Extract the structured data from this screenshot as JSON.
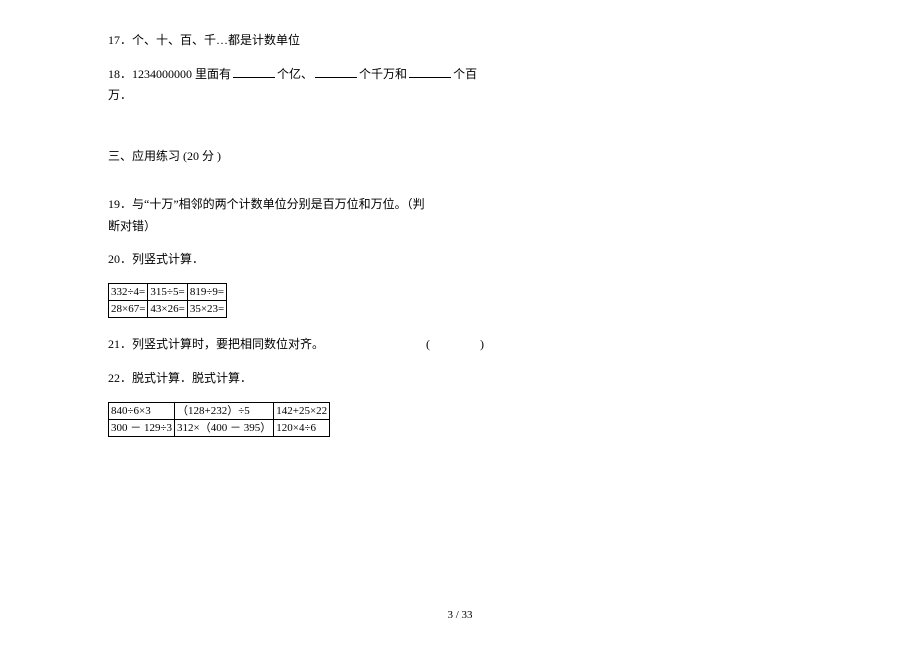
{
  "q17": {
    "num": "17．",
    "text": "个、十、百、千…都是计数单位"
  },
  "q18": {
    "num": "18．",
    "text_a": "1234000000 里面有",
    "text_b": "个亿、",
    "text_c": "个千万和",
    "text_d": "个百",
    "text_e": "万．"
  },
  "section3": {
    "title": "三、应用练习  (20  分 )"
  },
  "q19": {
    "num": "19．",
    "text_a": "与“十万”相邻的两个计数单位分别是百万位和万位。（判",
    "text_b": "断对错）"
  },
  "q20": {
    "num": "20．",
    "text": "列竖式计算．",
    "table": {
      "r1c1": "332÷4=",
      "r1c2": "315÷5=",
      "r1c3": "819÷9=",
      "r2c1": "28×67=",
      "r2c2": "43×26=",
      "r2c3": "35×23="
    }
  },
  "q21": {
    "num": "21．",
    "text": "列竖式计算时，要把相同数位对齐。",
    "paren_open": "(",
    "paren_close": ")"
  },
  "q22": {
    "num": "22．",
    "text": "脱式计算．脱式计算．",
    "table": {
      "r1c1": "840÷6×3",
      "r1c2": "（128+232）÷5",
      "r1c3": "142+25×22",
      "r2c1": "300 － 129÷3",
      "r2c2": "312×（400 － 395）",
      "r2c3": "120×4÷6"
    }
  },
  "page_number": "3 / 33"
}
